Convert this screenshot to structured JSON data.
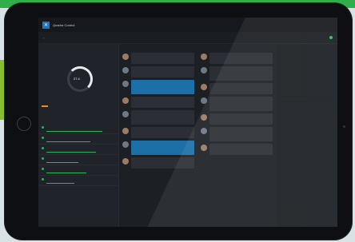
{
  "app": {
    "title": "Quadra Control"
  },
  "colors": {
    "accent": "#1a78c2",
    "green": "#2fae49",
    "orange": "#f08a24"
  },
  "gauge": {
    "value": "27.4"
  },
  "columns": [
    {
      "header": ""
    },
    {
      "header": ""
    }
  ]
}
